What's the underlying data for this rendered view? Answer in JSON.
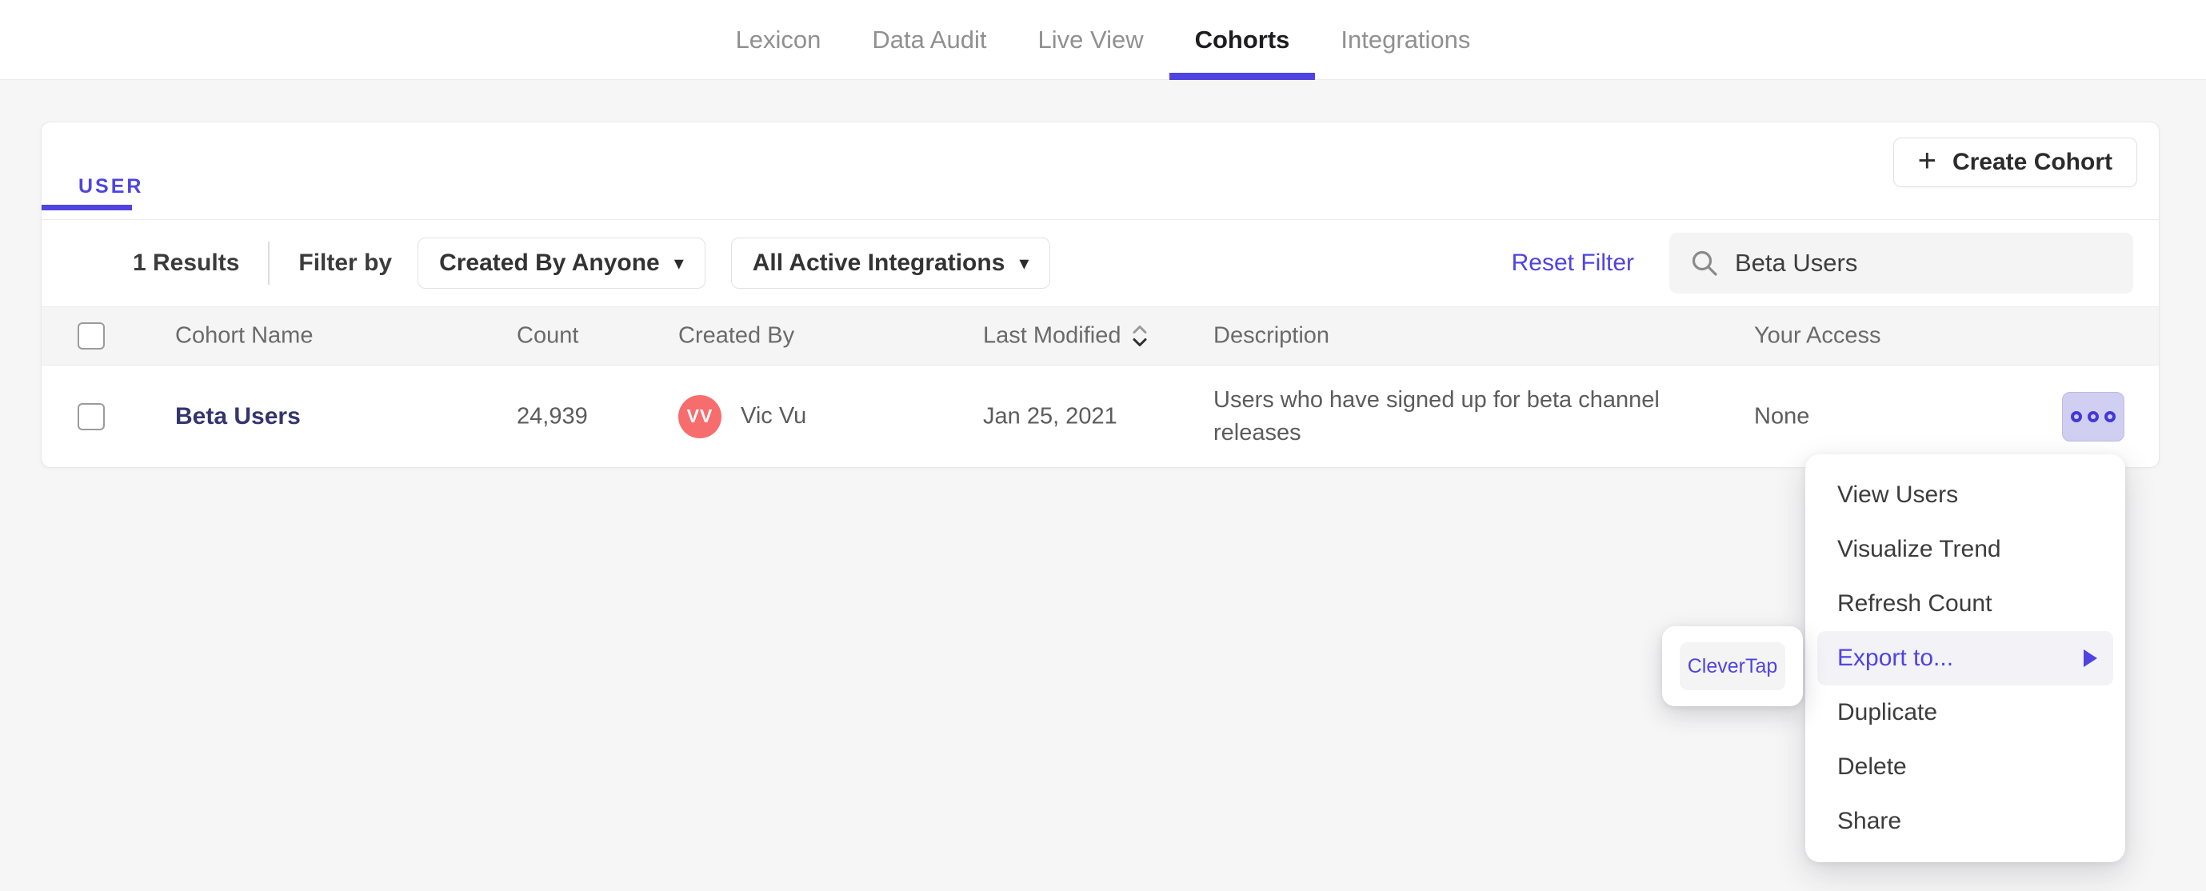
{
  "nav": {
    "items": [
      {
        "label": "Lexicon",
        "active": false
      },
      {
        "label": "Data Audit",
        "active": false
      },
      {
        "label": "Live View",
        "active": false
      },
      {
        "label": "Cohorts",
        "active": true
      },
      {
        "label": "Integrations",
        "active": false
      }
    ]
  },
  "card": {
    "tabs": {
      "user_label": "USER"
    },
    "create_button": {
      "label": "Create Cohort"
    },
    "filters": {
      "results_count": "1 Results",
      "filter_by_label": "Filter by",
      "created_by_dropdown": "Created By Anyone",
      "integrations_dropdown": "All Active Integrations",
      "reset_label": "Reset Filter",
      "search_value": "Beta Users"
    },
    "table": {
      "headers": {
        "cohort_name": "Cohort Name",
        "count": "Count",
        "created_by": "Created By",
        "last_modified": "Last Modified",
        "description": "Description",
        "your_access": "Your Access"
      },
      "rows": [
        {
          "name": "Beta Users",
          "count": "24,939",
          "creator_initials": "VV",
          "creator_name": "Vic Vu",
          "last_modified": "Jan 25, 2021",
          "description": "Users who have signed up for beta channel releases",
          "access": "None"
        }
      ]
    }
  },
  "context_menu": {
    "items": [
      {
        "label": "View Users"
      },
      {
        "label": "Visualize Trend"
      },
      {
        "label": "Refresh Count"
      },
      {
        "label": "Export to...",
        "highlighted": true,
        "has_submenu": true
      },
      {
        "label": "Duplicate"
      },
      {
        "label": "Delete"
      },
      {
        "label": "Share"
      }
    ]
  },
  "export_submenu": {
    "items": [
      {
        "label": "CleverTap"
      }
    ]
  },
  "icons": {
    "plus": "+",
    "caret_down": "▾"
  },
  "colors": {
    "accent": "#4f44e0",
    "avatar": "#f76d6d",
    "cohort_link": "#34346e",
    "more_button_bg": "#d1cff1",
    "menu_highlight_bg": "#f3f2f6",
    "table_header_bg": "#f5f5f5",
    "page_bg": "#f6f6f6"
  }
}
